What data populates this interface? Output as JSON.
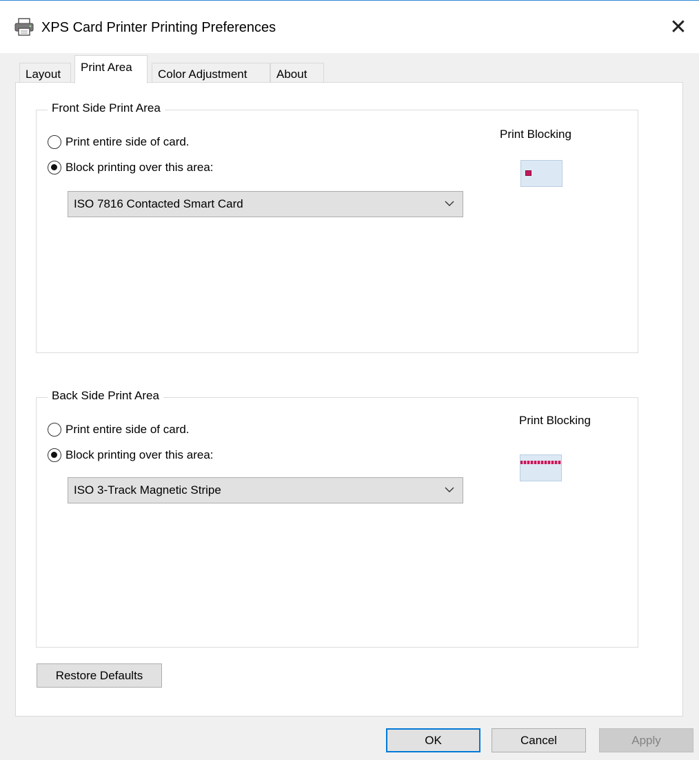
{
  "window": {
    "title": "XPS Card Printer Printing Preferences",
    "close_glyph": "✕"
  },
  "tabs": [
    {
      "label": "Layout",
      "active": false
    },
    {
      "label": "Print Area",
      "active": true
    },
    {
      "label": "Color Adjustment",
      "active": false
    },
    {
      "label": "About",
      "active": false
    }
  ],
  "front": {
    "legend": "Front Side Print Area",
    "option_entire": "Print entire side of card.",
    "option_block": "Block printing over this area:",
    "selected_option": "block",
    "area_select": "ISO 7816 Contacted Smart Card",
    "print_blocking_label": "Print Blocking",
    "thumbnail_icon": "smart-card-chip-icon"
  },
  "back": {
    "legend": "Back Side Print Area",
    "option_entire": "Print entire side of card.",
    "option_block": "Block printing over this area:",
    "selected_option": "block",
    "area_select": "ISO 3-Track Magnetic Stripe",
    "print_blocking_label": "Print Blocking",
    "thumbnail_icon": "magnetic-stripe-icon"
  },
  "buttons": {
    "restore_defaults": "Restore Defaults",
    "ok": "OK",
    "cancel": "Cancel",
    "apply": "Apply"
  },
  "colors": {
    "accent": "#0078d7",
    "card_fill": "#dce9f5",
    "blocking_mark": "#c2185b"
  }
}
